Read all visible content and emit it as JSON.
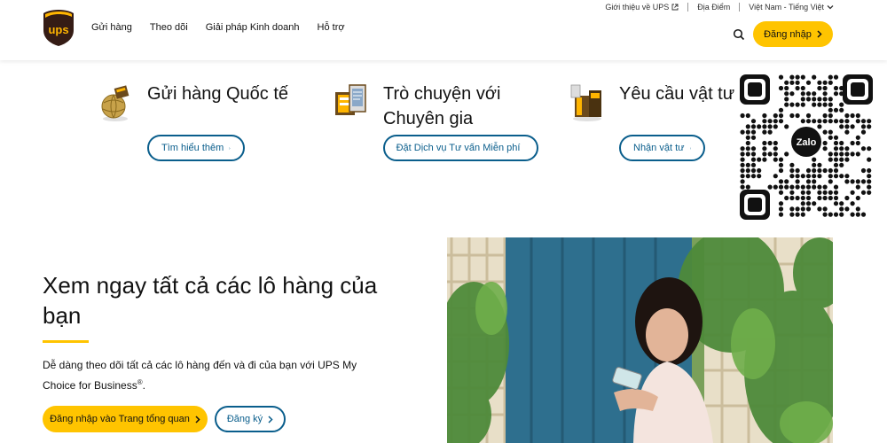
{
  "header": {
    "nav": [
      "Gửi hàng",
      "Theo dõi",
      "Giải pháp Kinh doanh",
      "Hỗ trợ"
    ],
    "utility": {
      "about": "Giới thiệu về UPS",
      "locations": "Địa Điểm",
      "language": "Việt Nam - Tiếng Việt"
    },
    "login_label": "Đăng nhập",
    "logo_text": "ups"
  },
  "features": [
    {
      "title": "Gửi hàng Quốc tế",
      "button": "Tìm hiểu thêm",
      "icon": "globe-package-icon"
    },
    {
      "title_line1": "Trò chuyện với",
      "title_line2": "Chuyên gia",
      "button": "Đặt Dịch vụ Tư vấn Miễn phí",
      "icon": "consult-laptop-icon"
    },
    {
      "title": "Yêu cầu vật tư",
      "button": "Nhận vật tư",
      "icon": "supplies-box-icon"
    }
  ],
  "qr": {
    "label": "Zalo"
  },
  "hero": {
    "title": "Xem ngay tất cả các lô hàng của bạn",
    "description_1": "Dễ dàng theo dõi tất cả các lô hàng đến và đi của bạn với UPS My Choice for Business",
    "description_sup": "®",
    "description_2": ".",
    "primary_button": "Đăng nhập vào Trang tổng quan",
    "secondary_button": "Đăng ký"
  },
  "colors": {
    "brand_yellow": "#ffc400",
    "link_blue": "#0a5e8c",
    "ups_brown": "#351c15"
  }
}
